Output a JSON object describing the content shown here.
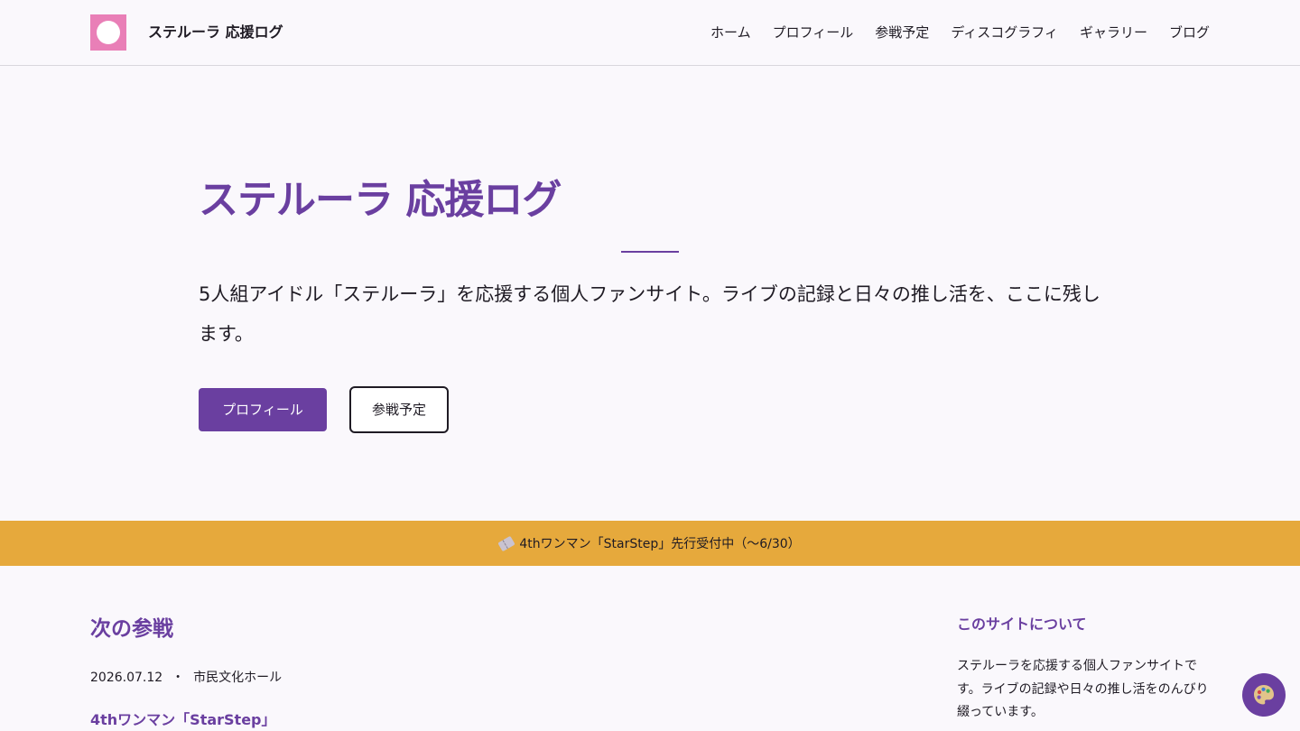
{
  "header": {
    "site_name": "ステルーラ 応援ログ",
    "nav": [
      "ホーム",
      "プロフィール",
      "参戦予定",
      "ディスコグラフィ",
      "ギャラリー",
      "ブログ"
    ]
  },
  "hero": {
    "title": "ステルーラ 応援ログ",
    "lead": "5人組アイドル「ステルーラ」を応援する個人ファンサイト。ライブの記録と日々の推し活を、ここに残します。",
    "primary_button": "プロフィール",
    "secondary_button": "参戦予定"
  },
  "announcement": {
    "icon": "ticket-icon",
    "text": "4thワンマン「StarStep」先行受付中（〜6/30）"
  },
  "next_event": {
    "section_title": "次の参戦",
    "date": "2026.07.12",
    "separator": "・",
    "venue": "市民文化ホール",
    "title": "4thワンマン「StarStep」"
  },
  "sidebar": {
    "title": "このサイトについて",
    "text": "ステルーラを応援する個人ファンサイトです。ライブの記録や日々の推し活をのんびり綴っています。"
  },
  "fab": {
    "icon": "palette-icon"
  },
  "colors": {
    "accent": "#6a3fa0",
    "logo": "#e97fb7",
    "banner": "#e6a93c",
    "background": "#faf8fc"
  }
}
